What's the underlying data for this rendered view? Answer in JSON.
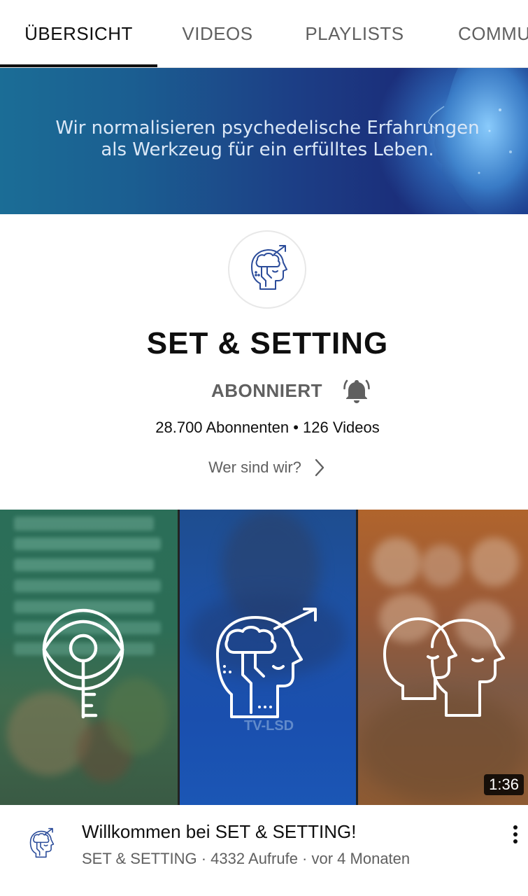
{
  "tabs": [
    {
      "label": "ÜBERSICHT",
      "active": true
    },
    {
      "label": "VIDEOS",
      "active": false
    },
    {
      "label": "PLAYLISTS",
      "active": false
    },
    {
      "label": "COMMU",
      "active": false
    }
  ],
  "banner": {
    "line1": "Wir normalisieren psychedelische Erfahrungen",
    "line2": "als Werkzeug für ein erfülltes Leben."
  },
  "channel": {
    "name": "SET & SETTING",
    "subscribe_label": "ABONNIERT",
    "stats": "28.700 Abonnenten • 126 Videos",
    "about_label": "Wer sind wir?",
    "avatar_icon": "head-brain-arrow-icon"
  },
  "trailer": {
    "duration": "1:36",
    "panel_icons": [
      "eye-key-icon",
      "head-brain-arrow-icon",
      "two-heads-icon"
    ],
    "panel2_text": "TV-LSD",
    "title": "Willkommen bei SET & SETTING!",
    "subtitle": "SET & SETTING · 4332 Aufrufe · vor 4 Monaten"
  },
  "colors": {
    "accent": "#0f0f0f",
    "secondary_text": "#606060",
    "banner_blue": "#1c3f86",
    "logo_blue": "#2b4c9a"
  }
}
